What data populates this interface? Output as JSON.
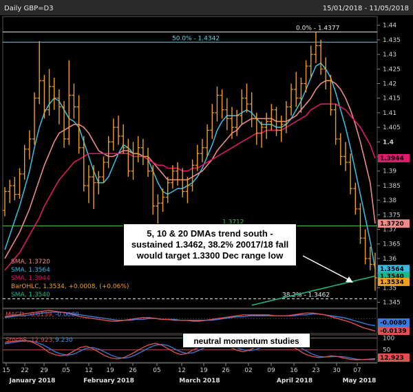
{
  "header": {
    "title": "Daily GBP=D3",
    "range": "15/01/2018 - 11/05/2018"
  },
  "chart_data": {
    "type": "candlestick",
    "price_ylim": [
      1.343,
      1.443
    ],
    "price_ticks": [
      "1.44",
      "1.435",
      "1.43",
      "1.425",
      "1.42",
      "1.415",
      "1.41",
      "1.405",
      "1.4",
      "1.395",
      "1.39",
      "1.385",
      "1.38",
      "1.375",
      "1.37",
      "1.365",
      "1.36",
      "1.355",
      "1.35",
      "1.345"
    ],
    "x_ticks": [
      "15",
      "22",
      "29",
      "05",
      "12",
      "19",
      "26",
      "05",
      "12",
      "19",
      "26",
      "02",
      "09",
      "16",
      "23",
      "30",
      "07"
    ],
    "x_months": [
      "January 2018",
      "February 2018",
      "March 2018",
      "April 2018",
      "May 2018"
    ],
    "bars": [
      [
        1.3765,
        1.3845,
        1.3745,
        1.383
      ],
      [
        1.383,
        1.387,
        1.379,
        1.385
      ],
      [
        1.385,
        1.388,
        1.38,
        1.382
      ],
      [
        1.382,
        1.391,
        1.3805,
        1.389
      ],
      [
        1.389,
        1.399,
        1.387,
        1.3975
      ],
      [
        1.3975,
        1.404,
        1.394,
        1.401
      ],
      [
        1.401,
        1.417,
        1.399,
        1.415
      ],
      [
        1.415,
        1.4345,
        1.413,
        1.421
      ],
      [
        1.421,
        1.423,
        1.408,
        1.411
      ],
      [
        1.411,
        1.425,
        1.409,
        1.419
      ],
      [
        1.419,
        1.422,
        1.411,
        1.415
      ],
      [
        1.415,
        1.418,
        1.406,
        1.412
      ],
      [
        1.412,
        1.414,
        1.398,
        1.401
      ],
      [
        1.401,
        1.428,
        1.399,
        1.416
      ],
      [
        1.416,
        1.42,
        1.408,
        1.412
      ],
      [
        1.412,
        1.416,
        1.396,
        1.398
      ],
      [
        1.398,
        1.402,
        1.383,
        1.385
      ],
      [
        1.385,
        1.392,
        1.379,
        1.388
      ],
      [
        1.388,
        1.392,
        1.377,
        1.386
      ],
      [
        1.386,
        1.39,
        1.382,
        1.388
      ],
      [
        1.388,
        1.395,
        1.386,
        1.393
      ],
      [
        1.393,
        1.402,
        1.391,
        1.4
      ],
      [
        1.4,
        1.408,
        1.397,
        1.405
      ],
      [
        1.405,
        1.409,
        1.399,
        1.402
      ],
      [
        1.402,
        1.406,
        1.396,
        1.398
      ],
      [
        1.398,
        1.401,
        1.388,
        1.39
      ],
      [
        1.39,
        1.4,
        1.387,
        1.396
      ],
      [
        1.396,
        1.402,
        1.393,
        1.398
      ],
      [
        1.398,
        1.401,
        1.392,
        1.395
      ],
      [
        1.395,
        1.398,
        1.388,
        1.39
      ],
      [
        1.39,
        1.392,
        1.375,
        1.378
      ],
      [
        1.378,
        1.382,
        1.3712,
        1.379
      ],
      [
        1.379,
        1.384,
        1.376,
        1.381
      ],
      [
        1.381,
        1.388,
        1.379,
        1.386
      ],
      [
        1.386,
        1.392,
        1.384,
        1.39
      ],
      [
        1.39,
        1.393,
        1.385,
        1.387
      ],
      [
        1.387,
        1.391,
        1.381,
        1.383
      ],
      [
        1.383,
        1.388,
        1.379,
        1.385
      ],
      [
        1.385,
        1.394,
        1.383,
        1.392
      ],
      [
        1.392,
        1.399,
        1.39,
        1.396
      ],
      [
        1.396,
        1.401,
        1.393,
        1.398
      ],
      [
        1.398,
        1.406,
        1.395,
        1.404
      ],
      [
        1.404,
        1.413,
        1.401,
        1.41
      ],
      [
        1.41,
        1.419,
        1.407,
        1.416
      ],
      [
        1.416,
        1.418,
        1.408,
        1.411
      ],
      [
        1.411,
        1.415,
        1.404,
        1.408
      ],
      [
        1.408,
        1.412,
        1.401,
        1.405
      ],
      [
        1.405,
        1.411,
        1.402,
        1.409
      ],
      [
        1.409,
        1.418,
        1.406,
        1.415
      ],
      [
        1.415,
        1.42,
        1.41,
        1.413
      ],
      [
        1.413,
        1.417,
        1.405,
        1.408
      ],
      [
        1.408,
        1.41,
        1.399,
        1.403
      ],
      [
        1.403,
        1.407,
        1.398,
        1.405
      ],
      [
        1.405,
        1.41,
        1.401,
        1.407
      ],
      [
        1.407,
        1.413,
        1.404,
        1.411
      ],
      [
        1.411,
        1.412,
        1.402,
        1.404
      ],
      [
        1.404,
        1.409,
        1.4,
        1.406
      ],
      [
        1.406,
        1.414,
        1.403,
        1.412
      ],
      [
        1.412,
        1.42,
        1.409,
        1.418
      ],
      [
        1.418,
        1.424,
        1.412,
        1.415
      ],
      [
        1.415,
        1.422,
        1.41,
        1.42
      ],
      [
        1.42,
        1.428,
        1.417,
        1.426
      ],
      [
        1.426,
        1.433,
        1.422,
        1.43
      ],
      [
        1.43,
        1.4377,
        1.427,
        1.433
      ],
      [
        1.433,
        1.435,
        1.423,
        1.425
      ],
      [
        1.425,
        1.429,
        1.418,
        1.421
      ],
      [
        1.421,
        1.423,
        1.409,
        1.411
      ],
      [
        1.411,
        1.413,
        1.399,
        1.401
      ],
      [
        1.401,
        1.403,
        1.392,
        1.395
      ],
      [
        1.395,
        1.4,
        1.39,
        1.393
      ],
      [
        1.393,
        1.396,
        1.382,
        1.384
      ],
      [
        1.384,
        1.386,
        1.375,
        1.377
      ],
      [
        1.377,
        1.379,
        1.365,
        1.367
      ],
      [
        1.367,
        1.37,
        1.358,
        1.36
      ],
      [
        1.36,
        1.364,
        1.356,
        1.358
      ],
      [
        1.358,
        1.362,
        1.349,
        1.3534
      ]
    ],
    "dma_series": [
      {
        "color": "#3ab8e0",
        "values": [
          1.363,
          1.368,
          1.373,
          1.378,
          1.384,
          1.39,
          1.398,
          1.405,
          1.41,
          1.413,
          1.415,
          1.414,
          1.411,
          1.408,
          1.407,
          1.405,
          1.4,
          1.395,
          1.39,
          1.386,
          1.386,
          1.388,
          1.392,
          1.396,
          1.399,
          1.398,
          1.396,
          1.396,
          1.395,
          1.394,
          1.39,
          1.386,
          1.383,
          1.382,
          1.383,
          1.384,
          1.384,
          1.385,
          1.386,
          1.388,
          1.391,
          1.395,
          1.399,
          1.404,
          1.407,
          1.409,
          1.409,
          1.409,
          1.41,
          1.411,
          1.41,
          1.408,
          1.406,
          1.406,
          1.406,
          1.405,
          1.405,
          1.406,
          1.408,
          1.411,
          1.414,
          1.418,
          1.422,
          1.426,
          1.427,
          1.425,
          1.422,
          1.417,
          1.411,
          1.405,
          1.398,
          1.39,
          1.382,
          1.374,
          1.366,
          1.3564
        ]
      },
      {
        "color": "#f08a8a",
        "values": [
          1.36,
          1.363,
          1.366,
          1.369,
          1.373,
          1.377,
          1.382,
          1.387,
          1.392,
          1.396,
          1.4,
          1.403,
          1.404,
          1.405,
          1.406,
          1.406,
          1.405,
          1.403,
          1.4,
          1.397,
          1.396,
          1.395,
          1.395,
          1.396,
          1.397,
          1.397,
          1.396,
          1.396,
          1.395,
          1.395,
          1.393,
          1.391,
          1.389,
          1.387,
          1.387,
          1.387,
          1.387,
          1.387,
          1.388,
          1.389,
          1.39,
          1.392,
          1.394,
          1.397,
          1.399,
          1.401,
          1.403,
          1.404,
          1.406,
          1.407,
          1.408,
          1.408,
          1.408,
          1.408,
          1.408,
          1.407,
          1.407,
          1.407,
          1.408,
          1.409,
          1.411,
          1.413,
          1.415,
          1.418,
          1.42,
          1.421,
          1.421,
          1.42,
          1.418,
          1.415,
          1.411,
          1.406,
          1.4,
          1.393,
          1.386,
          1.372
        ]
      },
      {
        "color": "#e0196a",
        "values": [
          1.356,
          1.358,
          1.36,
          1.362,
          1.365,
          1.368,
          1.371,
          1.374,
          1.378,
          1.381,
          1.384,
          1.387,
          1.389,
          1.391,
          1.393,
          1.394,
          1.395,
          1.396,
          1.396,
          1.396,
          1.396,
          1.396,
          1.396,
          1.396,
          1.396,
          1.396,
          1.395,
          1.395,
          1.395,
          1.394,
          1.393,
          1.392,
          1.392,
          1.391,
          1.391,
          1.391,
          1.39,
          1.39,
          1.391,
          1.391,
          1.392,
          1.393,
          1.394,
          1.395,
          1.396,
          1.397,
          1.398,
          1.399,
          1.4,
          1.401,
          1.402,
          1.403,
          1.403,
          1.404,
          1.404,
          1.404,
          1.404,
          1.405,
          1.406,
          1.407,
          1.408,
          1.409,
          1.411,
          1.412,
          1.413,
          1.413,
          1.413,
          1.413,
          1.412,
          1.411,
          1.409,
          1.407,
          1.405,
          1.402,
          1.399,
          1.3944
        ]
      },
      {
        "color": "#18b88a",
        "values": [
          1.344,
          1.3444,
          1.3448,
          1.3452,
          1.3456,
          1.346,
          1.3464,
          1.3468,
          1.3472,
          1.3476,
          1.348,
          1.3484,
          1.3488,
          1.3492,
          1.3496,
          1.35,
          1.3504,
          1.3508,
          1.3512,
          1.3516,
          1.352,
          1.3524,
          1.3528,
          1.3532,
          1.3536,
          1.354
        ]
      }
    ],
    "legend": [
      {
        "text": "SMA, 1.3720",
        "color": "#f08a8a"
      },
      {
        "text": "SMA, 1.3564",
        "color": "#3ab8e0"
      },
      {
        "text": "SMA, 1.3944",
        "color": "#e0196a"
      },
      {
        "text": "BarOHLC, 1.3534, +0.0008, (+0.06%)",
        "color": "#f0a020"
      },
      {
        "text": "SMA, 1.3540",
        "color": "#18b88a"
      }
    ],
    "levels": [
      {
        "value": 1.4377,
        "label": "0.0% - 1.4377",
        "color": "#e8e8e8",
        "dash": false
      },
      {
        "value": 1.4342,
        "label": "50.0% - 1.4342",
        "color": "#6ed0e0",
        "dash": false
      },
      {
        "value": 1.3712,
        "label": "1.3712",
        "color": "#44cc44",
        "dash": false
      },
      {
        "value": 1.3462,
        "label": "38.2% - 1.3462",
        "color": "#e8e8e8",
        "dash": true
      }
    ],
    "right_tags": [
      {
        "value": 1.3944,
        "text": "1.3944",
        "bg": "#e0196a",
        "fg": "#000"
      },
      {
        "value": 1.372,
        "text": "1.3720",
        "bg": "#f08a8a",
        "fg": "#000"
      },
      {
        "value": 1.3564,
        "text": "1.3564",
        "bg": "#3ab8e0",
        "fg": "#000"
      },
      {
        "value": 1.354,
        "text": "1.3540",
        "bg": "#18b88a",
        "fg": "#000"
      },
      {
        "value": 1.3534,
        "text": "1.3534",
        "bg": "#f0a020",
        "fg": "#000"
      }
    ],
    "annotation": "5, 10 & 20 DMAs trend south - sustained 1.3462, 38.2% 20017/18 fall would target 1.3300 Dec range low",
    "macd": {
      "label": "MACD, -0.0139, -0.0080",
      "macd_label": "MACD, -0.0139,",
      "signal_label": "-0.0080",
      "macd_value": -0.0139,
      "signal_value": -0.008,
      "macd_tag": "-0.0139",
      "signal_tag": "-0.0080",
      "macd_color": "#e05050",
      "signal_color": "#3a7ae0",
      "ylim": [
        -0.016,
        0.01
      ],
      "macd_values": [
        0.002,
        0.003,
        0.004,
        0.005,
        0.006,
        0.007,
        0.008,
        0.009,
        0.008,
        0.007,
        0.006,
        0.004,
        0.002,
        0.001,
        0.0,
        -0.001,
        -0.002,
        -0.003,
        -0.003,
        -0.002,
        -0.001,
        0.0,
        0.001,
        0.001,
        0.0,
        -0.001,
        -0.001,
        -0.002,
        -0.002,
        -0.002,
        -0.003,
        -0.003,
        -0.002,
        -0.001,
        0.0,
        0.001,
        0.002,
        0.003,
        0.004,
        0.004,
        0.004,
        0.004,
        0.004,
        0.003,
        0.003,
        0.003,
        0.004,
        0.005,
        0.006,
        0.006,
        0.005,
        0.004,
        0.002,
        0.0,
        -0.002,
        -0.004,
        -0.007,
        -0.01,
        -0.012,
        -0.0139
      ],
      "signal_values": [
        0.001,
        0.002,
        0.003,
        0.003,
        0.004,
        0.005,
        0.006,
        0.007,
        0.007,
        0.007,
        0.006,
        0.005,
        0.004,
        0.003,
        0.002,
        0.001,
        0.0,
        -0.001,
        -0.002,
        -0.002,
        -0.002,
        -0.001,
        -0.001,
        0.0,
        0.0,
        -0.001,
        -0.001,
        -0.001,
        -0.002,
        -0.002,
        -0.002,
        -0.002,
        -0.002,
        -0.002,
        -0.001,
        0.0,
        0.001,
        0.002,
        0.002,
        0.003,
        0.003,
        0.003,
        0.003,
        0.003,
        0.003,
        0.003,
        0.003,
        0.004,
        0.004,
        0.005,
        0.005,
        0.004,
        0.003,
        0.002,
        0.001,
        -0.001,
        -0.003,
        -0.005,
        -0.007,
        -0.008
      ]
    },
    "stoch": {
      "label": "StochS, 12.923, 9.230",
      "stoch_label": "StochS, 12.923,",
      "signal_label": "9.230",
      "k_value": 12.923,
      "d_value": 9.23,
      "tag": "12.923",
      "ticks": [
        "100",
        "50"
      ],
      "ylim": [
        0,
        110
      ],
      "k_color": "#e05050",
      "d_color": "#3a7ae0",
      "k_values": [
        80,
        85,
        88,
        90,
        86,
        75,
        60,
        40,
        30,
        25,
        30,
        45,
        60,
        65,
        55,
        40,
        25,
        15,
        12,
        18,
        30,
        45,
        60,
        72,
        78,
        70,
        55,
        40,
        30,
        35,
        50,
        62,
        70,
        74,
        76,
        70,
        60,
        48,
        42,
        50,
        62,
        75,
        84,
        88,
        85,
        76,
        62,
        45,
        30,
        22,
        18,
        20,
        25,
        22,
        15,
        10,
        8,
        9,
        11,
        12.923
      ],
      "d_values": [
        75,
        80,
        84,
        87,
        88,
        82,
        72,
        58,
        42,
        32,
        28,
        32,
        45,
        57,
        60,
        53,
        40,
        27,
        18,
        15,
        20,
        31,
        45,
        59,
        70,
        73,
        68,
        55,
        42,
        35,
        38,
        49,
        61,
        69,
        73,
        73,
        69,
        59,
        50,
        47,
        51,
        62,
        74,
        82,
        86,
        83,
        74,
        61,
        46,
        32,
        23,
        20,
        21,
        22,
        21,
        16,
        11,
        9,
        9,
        9.23
      ]
    },
    "stoch_note": "neutral momentum studies"
  }
}
